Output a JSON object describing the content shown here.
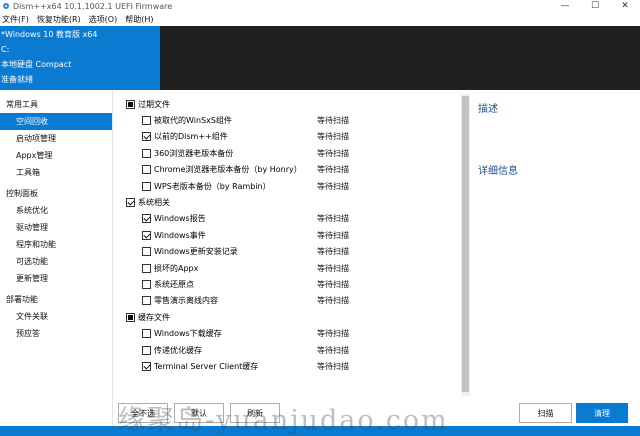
{
  "window": {
    "title": "Dism++x64 10.1.1002.1 UEFI Firmware",
    "min_symbol": "—",
    "max_symbol": "☐",
    "close_symbol": "✕"
  },
  "menu": [
    "文件(F)",
    "恢复功能(R)",
    "选项(O)",
    "帮助(H)"
  ],
  "info": {
    "os": "*Windows 10 教育版 x64",
    "drive": "C:",
    "disk": "本地硬盘 Compact",
    "status": "准备就绪"
  },
  "sidebar": {
    "groups": [
      {
        "label": "常用工具",
        "items": [
          "空间回收",
          "启动项管理",
          "Appx管理",
          "工具箱"
        ]
      },
      {
        "label": "控制面板",
        "items": [
          "系统优化",
          "驱动管理",
          "程序和功能",
          "可选功能",
          "更新管理"
        ]
      },
      {
        "label": "部署功能",
        "items": [
          "文件关联",
          "预应答"
        ]
      }
    ],
    "selected": "空间回收"
  },
  "list": {
    "groups": [
      {
        "label": "过期文件",
        "state": "partial",
        "items": [
          {
            "label": "被取代的WinSxS组件",
            "checked": false,
            "status": "等待扫描"
          },
          {
            "label": "以前的Dism++组件",
            "checked": true,
            "status": "等待扫描"
          },
          {
            "label": "360浏览器老版本备份",
            "checked": false,
            "status": "等待扫描"
          },
          {
            "label": "Chrome浏览器老版本备份（by Honry）",
            "checked": false,
            "status": "等待扫描"
          },
          {
            "label": "WPS老版本备份（by Rambin）",
            "checked": false,
            "status": "等待扫描"
          }
        ]
      },
      {
        "label": "系统相关",
        "state": "checked",
        "items": [
          {
            "label": "Windows报告",
            "checked": true,
            "status": "等待扫描"
          },
          {
            "label": "Windows事件",
            "checked": true,
            "status": "等待扫描"
          },
          {
            "label": "Windows更新安装记录",
            "checked": false,
            "status": "等待扫描"
          },
          {
            "label": "损坏的Appx",
            "checked": false,
            "status": "等待扫描"
          },
          {
            "label": "系统还原点",
            "checked": false,
            "status": "等待扫描"
          },
          {
            "label": "零售演示离线内容",
            "checked": false,
            "status": "等待扫描"
          }
        ]
      },
      {
        "label": "缓存文件",
        "state": "partial",
        "items": [
          {
            "label": "Windows下载缓存",
            "checked": false,
            "status": "等待扫描"
          },
          {
            "label": "传递优化缓存",
            "checked": false,
            "status": "等待扫描"
          },
          {
            "label": "Terminal Server Client缓存",
            "checked": true,
            "status": "等待扫描"
          }
        ]
      }
    ]
  },
  "right_panel": {
    "desc_title": "描述",
    "detail_title": "详细信息"
  },
  "buttons": {
    "select_all": "全不选",
    "default": "默认",
    "refresh": "刷新",
    "scan": "扫描",
    "clean": "清理"
  },
  "watermark": "缘聚岛-yuanjudao.com",
  "colors": {
    "accent": "#0b7ad1",
    "dark": "#1f1f1f",
    "heading": "#1f4e8c"
  }
}
